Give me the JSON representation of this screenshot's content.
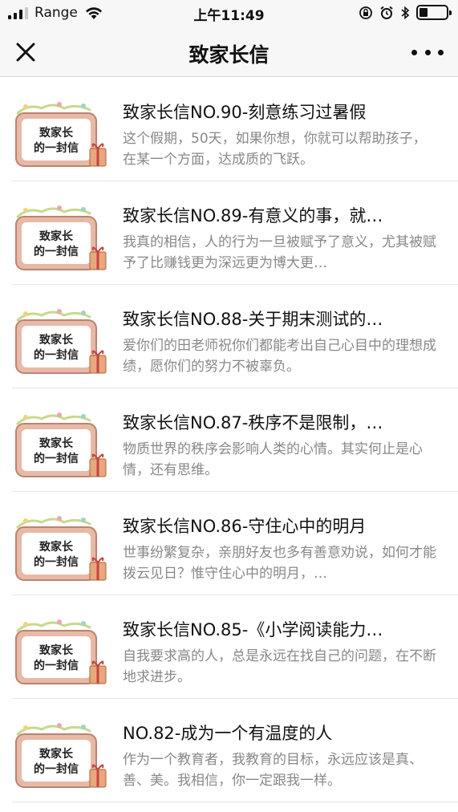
{
  "status_bar": {
    "carrier": "Range",
    "time": "上午11:49"
  },
  "nav": {
    "title": "致家长信",
    "close_icon": "close-icon",
    "more_icon": "more-icon"
  },
  "thumbnail_text": [
    "致家长",
    "的一封信"
  ],
  "articles": [
    {
      "title": "致家长信NO.90-刻意练习过暑假",
      "desc": "这个假期，50天，如果你想，你就可以帮助孩子，在某一个方面，达成质的飞跃。"
    },
    {
      "title": "致家长信NO.89-有意义的事，就…",
      "desc": "我真的相信，人的行为一旦被赋予了意义，尤其被赋予了比赚钱更为深远更为博大更…"
    },
    {
      "title": "致家长信NO.88-关于期末测试的…",
      "desc": "爱你们的田老师祝你们都能考出自己心目中的理想成绩，愿你们的努力不被辜负。"
    },
    {
      "title": "致家长信NO.87-秩序不是限制，…",
      "desc": "物质世界的秩序会影响人类的心情。其实何止是心情，还有思维。"
    },
    {
      "title": "致家长信NO.86-守住心中的明月",
      "desc": "世事纷繁复杂，亲朋好友也多有善意劝说，如何才能拨云见日？惟守住心中的明月，…"
    },
    {
      "title": "致家长信NO.85-《小学阅读能力…",
      "desc": "自我要求高的人，总是永远在找自己的问题，在不断地求进步。"
    },
    {
      "title": "NO.82-成为一个有温度的人",
      "desc": "作为一个教育者，我教育的目标，永远应该是真、善、美。我相信，你一定跟我一样。"
    }
  ],
  "colors": {
    "bar_bg": "#f7f7f7",
    "title": "#111111",
    "desc": "#888888",
    "thumb_frame": "#e8b9a6",
    "thumb_vine": "#c8d98a",
    "thumb_gift": "#e9a77d"
  }
}
